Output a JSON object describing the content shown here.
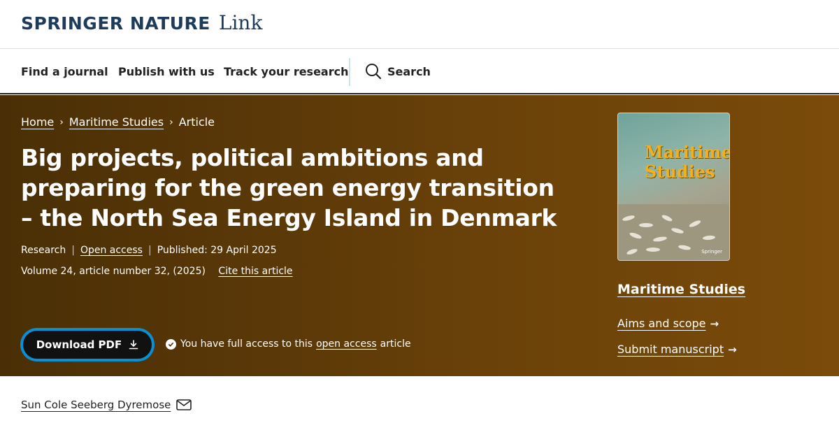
{
  "brand": {
    "name": "SPRINGER NATURE",
    "suffix": "Link"
  },
  "nav": {
    "items": [
      "Find a journal",
      "Publish with us",
      "Track your research"
    ],
    "search_label": "Search"
  },
  "breadcrumb": {
    "home": "Home",
    "journal": "Maritime Studies",
    "current": "Article",
    "separator": "›"
  },
  "article": {
    "title": "Big projects, political ambitions and preparing for the green energy transition – the North Sea Energy Island in Denmark",
    "type": "Research",
    "access": "Open access",
    "published": "Published: 29 April 2025",
    "volume": "Volume 24, article number 32, (2025)",
    "cite": "Cite this article"
  },
  "download": {
    "label": "Download PDF"
  },
  "access_note": {
    "prefix": "You have full access to this",
    "link": "open access",
    "suffix": "article"
  },
  "sidebar": {
    "cover_title_line1": "Maritime",
    "cover_title_line2": "Studies",
    "cover_publisher": "Springer",
    "journal_name": "Maritime Studies",
    "links": [
      "Aims and scope",
      "Submit manuscript"
    ],
    "arrow": "→"
  },
  "author": {
    "name": "Sun Cole Seeberg Dyremose"
  },
  "colors": {
    "hero_brown": "#5c3908",
    "brand_navy": "#1f3b5b",
    "focus_blue": "#0a8fd3",
    "cover_gold": "#f2b01e"
  }
}
